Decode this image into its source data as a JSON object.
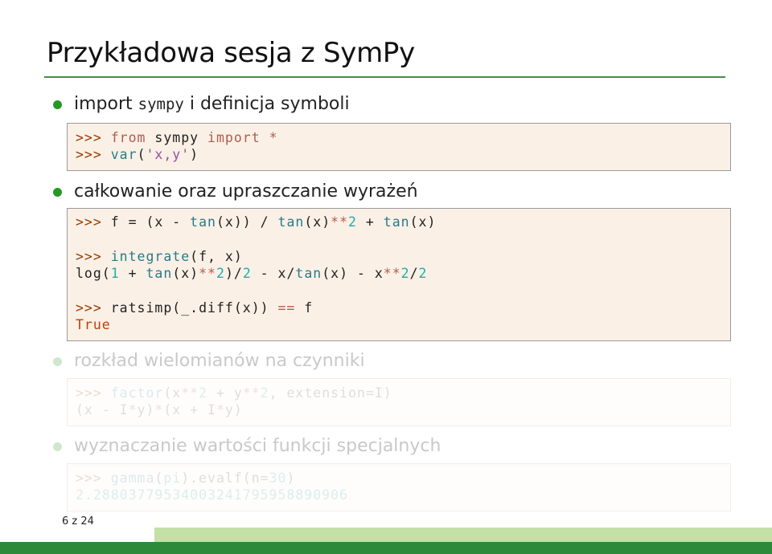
{
  "slide": {
    "title": "Przykładowa sesja z SymPy",
    "page_number": "6 z 24"
  },
  "items": [
    {
      "pre": "import ",
      "mono": "sympy",
      "post": " i definicja symboli",
      "faded": false,
      "code": [
        [
          {
            "c": "p",
            "t": ">>> "
          },
          {
            "c": "k",
            "t": "from"
          },
          {
            "c": "",
            "t": " sympy "
          },
          {
            "c": "k",
            "t": "import"
          },
          {
            "c": "",
            "t": " "
          },
          {
            "c": "k",
            "t": "*"
          }
        ],
        [
          {
            "c": "p",
            "t": ">>> "
          },
          {
            "c": "fn",
            "t": "var"
          },
          {
            "c": "",
            "t": "("
          },
          {
            "c": "s",
            "t": "'x,y'"
          },
          {
            "c": "",
            "t": ")"
          }
        ]
      ]
    },
    {
      "text": "całkowanie oraz upraszczanie wyrażeń",
      "faded": false,
      "code": [
        [
          {
            "c": "p",
            "t": ">>> "
          },
          {
            "c": "",
            "t": "f = (x - "
          },
          {
            "c": "fn",
            "t": "tan"
          },
          {
            "c": "",
            "t": "(x)) / "
          },
          {
            "c": "fn",
            "t": "tan"
          },
          {
            "c": "",
            "t": "(x)"
          },
          {
            "c": "k",
            "t": "**"
          },
          {
            "c": "n",
            "t": "2"
          },
          {
            "c": "",
            "t": " + "
          },
          {
            "c": "fn",
            "t": "tan"
          },
          {
            "c": "",
            "t": "(x)"
          }
        ],
        [
          {
            "c": "p",
            "t": ">>> "
          },
          {
            "c": "fn",
            "t": "integrate"
          },
          {
            "c": "",
            "t": "(f, x)"
          }
        ],
        [
          {
            "c": "",
            "t": "log("
          },
          {
            "c": "n",
            "t": "1"
          },
          {
            "c": "",
            "t": " + "
          },
          {
            "c": "fn",
            "t": "tan"
          },
          {
            "c": "",
            "t": "(x)"
          },
          {
            "c": "k",
            "t": "**"
          },
          {
            "c": "n",
            "t": "2"
          },
          {
            "c": "",
            "t": ")/"
          },
          {
            "c": "n",
            "t": "2"
          },
          {
            "c": "",
            "t": " - x/"
          },
          {
            "c": "fn",
            "t": "tan"
          },
          {
            "c": "",
            "t": "(x) - x"
          },
          {
            "c": "k",
            "t": "**"
          },
          {
            "c": "n",
            "t": "2"
          },
          {
            "c": "",
            "t": "/"
          },
          {
            "c": "n",
            "t": "2"
          }
        ],
        [
          {
            "c": "p",
            "t": ">>> "
          },
          {
            "c": "",
            "t": "ratsimp(_.diff(x)) "
          },
          {
            "c": "k",
            "t": "=="
          },
          {
            "c": "",
            "t": " f"
          }
        ],
        [
          {
            "c": "t",
            "t": "True"
          }
        ]
      ]
    },
    {
      "text": "rozkład wielomianów na czynniki",
      "faded": true,
      "code": [
        [
          {
            "c": "p",
            "t": ">>> "
          },
          {
            "c": "fn",
            "t": "factor"
          },
          {
            "c": "",
            "t": "(x"
          },
          {
            "c": "k",
            "t": "**"
          },
          {
            "c": "n",
            "t": "2"
          },
          {
            "c": "",
            "t": " + y"
          },
          {
            "c": "k",
            "t": "**"
          },
          {
            "c": "n",
            "t": "2"
          },
          {
            "c": "",
            "t": ", extension=I)"
          }
        ],
        [
          {
            "c": "",
            "t": "(x - I"
          },
          {
            "c": "k",
            "t": "*"
          },
          {
            "c": "",
            "t": "y)"
          },
          {
            "c": "k",
            "t": "*"
          },
          {
            "c": "",
            "t": "(x + I"
          },
          {
            "c": "k",
            "t": "*"
          },
          {
            "c": "",
            "t": "y)"
          }
        ]
      ]
    },
    {
      "text": "wyznaczanie wartości funkcji specjalnych",
      "faded": true,
      "code": [
        [
          {
            "c": "p",
            "t": ">>> "
          },
          {
            "c": "fn",
            "t": "gamma"
          },
          {
            "c": "",
            "t": "("
          },
          {
            "c": "n",
            "t": "pi"
          },
          {
            "c": "",
            "t": ").evalf(n="
          },
          {
            "c": "n",
            "t": "30"
          },
          {
            "c": "",
            "t": ")"
          }
        ],
        [
          {
            "c": "n",
            "t": "2.28803779534003241795958890906"
          }
        ]
      ]
    }
  ]
}
